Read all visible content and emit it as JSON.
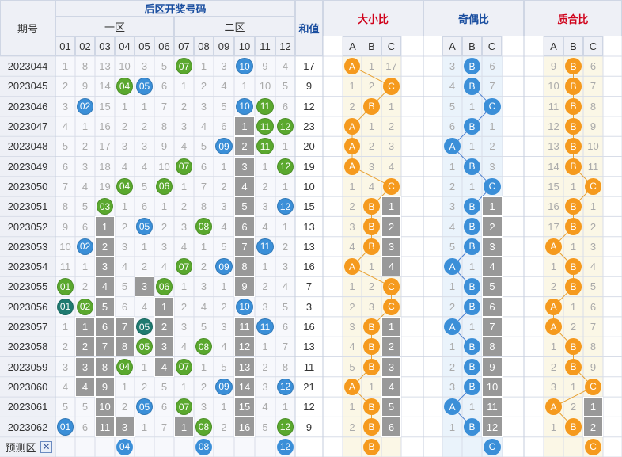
{
  "headers": {
    "period": "期号",
    "back_zone": "后区开奖号码",
    "zone1": "一区",
    "zone2": "二区",
    "sum": "和值",
    "size_ratio": "大小比",
    "odd_even_ratio": "奇偶比",
    "prime_ratio": "质合比",
    "abc": [
      "A",
      "B",
      "C"
    ]
  },
  "numbers": [
    "01",
    "02",
    "03",
    "04",
    "05",
    "06",
    "07",
    "08",
    "09",
    "10",
    "11",
    "12"
  ],
  "predict_label": "预测区",
  "predict_close_icon": "close-icon",
  "predict_values": {
    "numbers": [
      "04",
      "08",
      "12"
    ],
    "size": "B",
    "odd_even": "C",
    "prime": "C"
  },
  "colors": {
    "ball_blue": "#3b8fd8",
    "ball_green": "#5aa82e",
    "ball_orange": "#f59a1e",
    "ball_teal": "#1f7a70",
    "gray_box": "#999999",
    "header_bg": "#eef0f6",
    "ratio_title": "#d0021b"
  },
  "chart_data": {
    "type": "table",
    "rows": [
      {
        "period": "2023044",
        "cells": [
          "1",
          "8",
          "13",
          "10",
          "3",
          "5",
          "07",
          "1",
          "3",
          "10",
          "9",
          "4"
        ],
        "sum": "17",
        "size": [
          "A",
          "1",
          "17"
        ],
        "oe": [
          "3",
          "B",
          "6"
        ],
        "pc": [
          "9",
          "B",
          "6"
        ]
      },
      {
        "period": "2023045",
        "cells": [
          "2",
          "9",
          "14",
          "04",
          "05",
          "6",
          "1",
          "2",
          "4",
          "1",
          "10",
          "5"
        ],
        "sum": "9",
        "size": [
          "1",
          "2",
          "C"
        ],
        "oe": [
          "4",
          "B",
          "7"
        ],
        "pc": [
          "10",
          "B",
          "7"
        ]
      },
      {
        "period": "2023046",
        "cells": [
          "3",
          "02",
          "15",
          "1",
          "1",
          "7",
          "2",
          "3",
          "5",
          "10",
          "11",
          "6"
        ],
        "sum": "12",
        "size": [
          "2",
          "B",
          "1"
        ],
        "oe": [
          "5",
          "1",
          "C"
        ],
        "pc": [
          "11",
          "B",
          "8"
        ]
      },
      {
        "period": "2023047",
        "cells": [
          "4",
          "1",
          "16",
          "2",
          "2",
          "8",
          "3",
          "4",
          "6",
          "1",
          "11",
          "12"
        ],
        "sum": "23",
        "size": [
          "A",
          "1",
          "2"
        ],
        "oe": [
          "6",
          "B",
          "1"
        ],
        "pc": [
          "12",
          "B",
          "9"
        ]
      },
      {
        "period": "2023048",
        "cells": [
          "5",
          "2",
          "17",
          "3",
          "3",
          "9",
          "4",
          "5",
          "09",
          "2",
          "11",
          "1"
        ],
        "sum": "20",
        "size": [
          "A",
          "2",
          "3"
        ],
        "oe": [
          "A",
          "1",
          "2"
        ],
        "pc": [
          "13",
          "B",
          "10"
        ]
      },
      {
        "period": "2023049",
        "cells": [
          "6",
          "3",
          "18",
          "4",
          "4",
          "10",
          "07",
          "6",
          "1",
          "3",
          "1",
          "12"
        ],
        "sum": "19",
        "size": [
          "A",
          "3",
          "4"
        ],
        "oe": [
          "1",
          "B",
          "3"
        ],
        "pc": [
          "14",
          "B",
          "11"
        ]
      },
      {
        "period": "2023050",
        "cells": [
          "7",
          "4",
          "19",
          "04",
          "5",
          "06",
          "1",
          "7",
          "2",
          "4",
          "2",
          "1"
        ],
        "sum": "10",
        "size": [
          "1",
          "4",
          "C"
        ],
        "oe": [
          "2",
          "1",
          "C"
        ],
        "pc": [
          "15",
          "1",
          "C"
        ]
      },
      {
        "period": "2023051",
        "cells": [
          "8",
          "5",
          "03",
          "1",
          "6",
          "1",
          "2",
          "8",
          "3",
          "5",
          "3",
          "12"
        ],
        "sum": "15",
        "size": [
          "2",
          "B",
          "1"
        ],
        "oe": [
          "3",
          "B",
          "1"
        ],
        "pc": [
          "16",
          "B",
          "1"
        ]
      },
      {
        "period": "2023052",
        "cells": [
          "9",
          "6",
          "1",
          "2",
          "05",
          "2",
          "3",
          "08",
          "4",
          "6",
          "4",
          "1"
        ],
        "sum": "13",
        "size": [
          "3",
          "B",
          "2"
        ],
        "oe": [
          "4",
          "B",
          "2"
        ],
        "pc": [
          "17",
          "B",
          "2"
        ]
      },
      {
        "period": "2023053",
        "cells": [
          "10",
          "02",
          "2",
          "3",
          "1",
          "3",
          "4",
          "1",
          "5",
          "7",
          "11",
          "2"
        ],
        "sum": "13",
        "size": [
          "4",
          "B",
          "3"
        ],
        "oe": [
          "5",
          "B",
          "3"
        ],
        "pc": [
          "A",
          "1",
          "3"
        ]
      },
      {
        "period": "2023054",
        "cells": [
          "11",
          "1",
          "3",
          "4",
          "2",
          "4",
          "07",
          "2",
          "09",
          "8",
          "1",
          "3"
        ],
        "sum": "16",
        "size": [
          "A",
          "1",
          "4"
        ],
        "oe": [
          "A",
          "1",
          "4"
        ],
        "pc": [
          "1",
          "B",
          "4"
        ]
      },
      {
        "period": "2023055",
        "cells": [
          "01",
          "2",
          "4",
          "5",
          "3",
          "06",
          "1",
          "3",
          "1",
          "9",
          "2",
          "4"
        ],
        "sum": "7",
        "size": [
          "1",
          "2",
          "C"
        ],
        "oe": [
          "1",
          "B",
          "5"
        ],
        "pc": [
          "2",
          "B",
          "5"
        ]
      },
      {
        "period": "2023056",
        "cells": [
          "01",
          "02",
          "5",
          "6",
          "4",
          "1",
          "2",
          "4",
          "2",
          "10",
          "3",
          "5"
        ],
        "sum": "3",
        "size": [
          "2",
          "3",
          "C"
        ],
        "oe": [
          "2",
          "B",
          "6"
        ],
        "pc": [
          "A",
          "1",
          "6"
        ]
      },
      {
        "period": "2023057",
        "cells": [
          "1",
          "1",
          "6",
          "7",
          "05",
          "2",
          "3",
          "5",
          "3",
          "11",
          "11",
          "6"
        ],
        "sum": "16",
        "size": [
          "3",
          "B",
          "1"
        ],
        "oe": [
          "A",
          "1",
          "7"
        ],
        "pc": [
          "A",
          "2",
          "7"
        ]
      },
      {
        "period": "2023058",
        "cells": [
          "2",
          "2",
          "7",
          "8",
          "05",
          "3",
          "4",
          "08",
          "4",
          "12",
          "1",
          "7"
        ],
        "sum": "13",
        "size": [
          "4",
          "B",
          "2"
        ],
        "oe": [
          "1",
          "B",
          "8"
        ],
        "pc": [
          "1",
          "B",
          "8"
        ]
      },
      {
        "period": "2023059",
        "cells": [
          "3",
          "3",
          "8",
          "04",
          "1",
          "4",
          "07",
          "1",
          "5",
          "13",
          "2",
          "8"
        ],
        "sum": "11",
        "size": [
          "5",
          "B",
          "3"
        ],
        "oe": [
          "2",
          "B",
          "9"
        ],
        "pc": [
          "2",
          "B",
          "9"
        ]
      },
      {
        "period": "2023060",
        "cells": [
          "4",
          "4",
          "9",
          "1",
          "2",
          "5",
          "1",
          "2",
          "09",
          "14",
          "3",
          "12"
        ],
        "sum": "21",
        "size": [
          "A",
          "1",
          "4"
        ],
        "oe": [
          "3",
          "B",
          "10"
        ],
        "pc": [
          "3",
          "1",
          "C"
        ]
      },
      {
        "period": "2023061",
        "cells": [
          "5",
          "5",
          "10",
          "2",
          "05",
          "6",
          "07",
          "3",
          "1",
          "15",
          "4",
          "1"
        ],
        "sum": "12",
        "size": [
          "1",
          "B",
          "5"
        ],
        "oe": [
          "A",
          "1",
          "11"
        ],
        "pc": [
          "A",
          "2",
          "1"
        ]
      },
      {
        "period": "2023062",
        "cells": [
          "01",
          "6",
          "11",
          "3",
          "1",
          "7",
          "1",
          "08",
          "2",
          "16",
          "5",
          "12"
        ],
        "sum": "9",
        "size": [
          "2",
          "B",
          "6"
        ],
        "oe": [
          "1",
          "B",
          "12"
        ],
        "pc": [
          "1",
          "B",
          "2"
        ]
      }
    ]
  }
}
